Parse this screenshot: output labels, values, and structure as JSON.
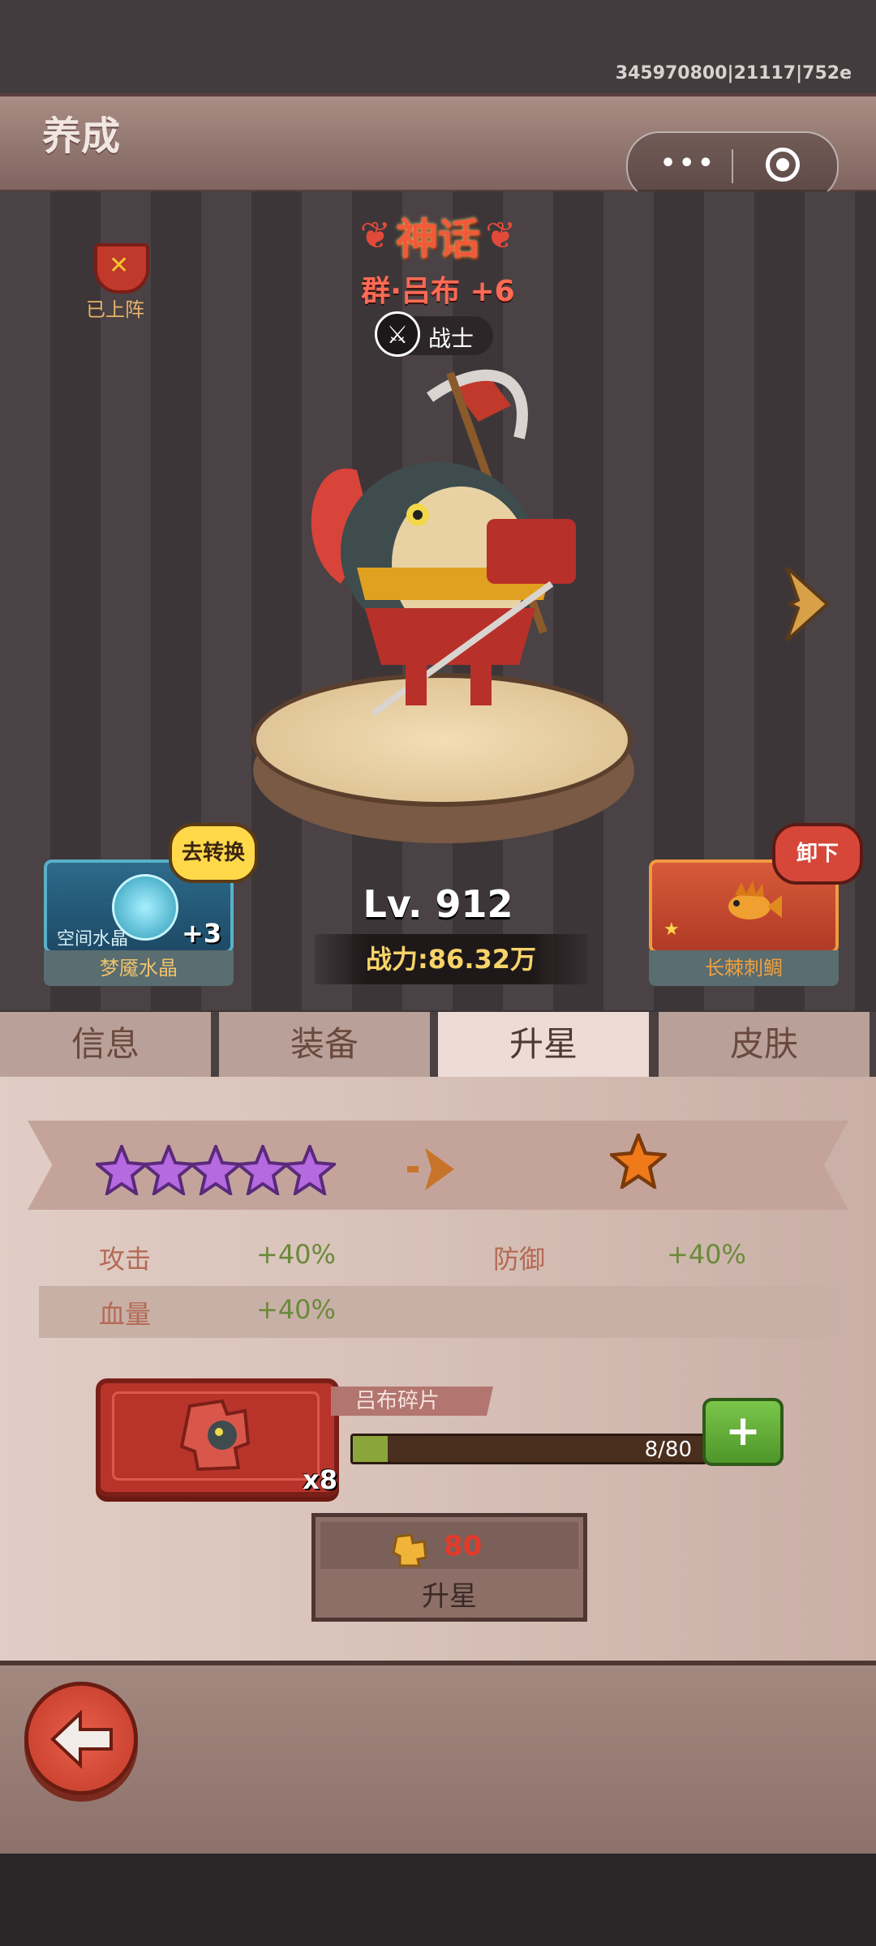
{
  "build_id": "345970800|21117|752e",
  "header": {
    "title": "养成"
  },
  "capsule": {
    "more_label": "•••"
  },
  "hero": {
    "deployed_label": "已上阵",
    "rank": "神话",
    "name": "群·吕布 +6",
    "class": "战士",
    "level": "Lv. 912",
    "power": "战力:86.32万"
  },
  "crystal": {
    "sublabel": "空间水晶",
    "plus": "+3",
    "name": "梦魇水晶",
    "action": "去转换"
  },
  "fish": {
    "name": "长棘刺鲷",
    "action": "卸下"
  },
  "tabs": [
    {
      "label": "信息"
    },
    {
      "label": "装备"
    },
    {
      "label": "升星"
    },
    {
      "label": "皮肤"
    }
  ],
  "star_up": {
    "from_stars": 5,
    "from_color": "#b56ae0",
    "to_stars": 1,
    "to_color": "#f07a1a",
    "stats": [
      {
        "name": "攻击",
        "value": "+40%"
      },
      {
        "name": "防御",
        "value": "+40%"
      },
      {
        "name": "血量",
        "value": "+40%"
      }
    ]
  },
  "shard": {
    "name": "吕布碎片",
    "count": "x8",
    "progress_text": "8/80",
    "progress": 0.1
  },
  "upgrade": {
    "cost": "80",
    "label": "升星"
  },
  "colors": {
    "accent_red": "#e43a2a",
    "green": "#6a8a3a"
  }
}
